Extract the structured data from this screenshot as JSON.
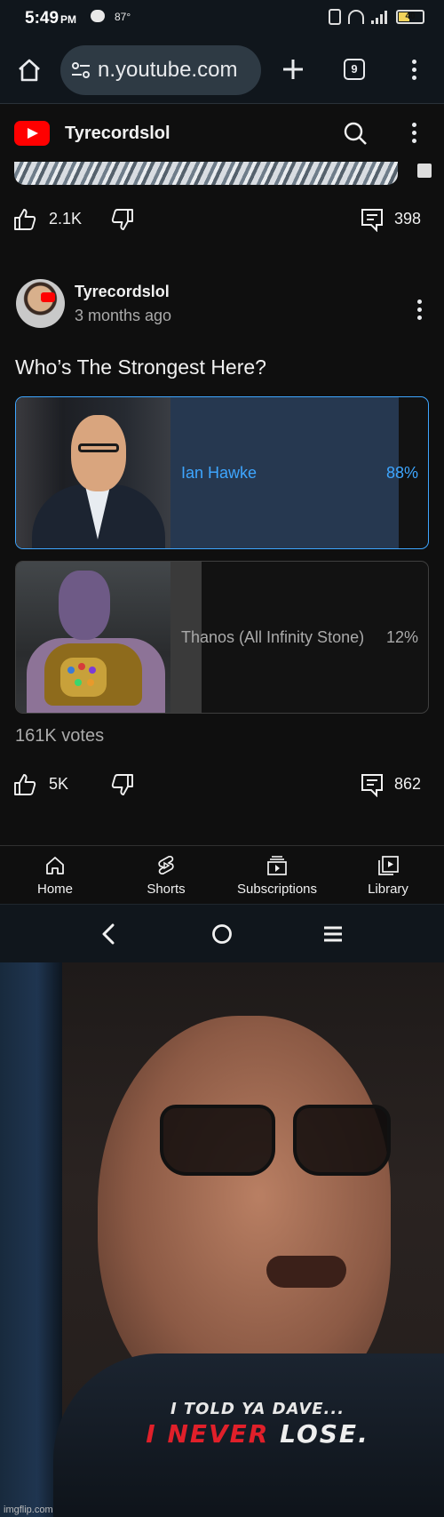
{
  "status_bar": {
    "time": "5:49",
    "ampm": "PM",
    "temperature": "87°",
    "battery": "40"
  },
  "browser": {
    "url": "n.youtube.com",
    "tab_count": "9"
  },
  "header": {
    "channel_title": "Tyrecordslol"
  },
  "previous_post": {
    "likes": "2.1K",
    "comments": "398"
  },
  "post": {
    "channel": "Tyrecordslol",
    "time_ago": "3 months ago",
    "question": "Who’s The Strongest Here?",
    "options": [
      {
        "label": "Ian Hawke",
        "percent": "88%",
        "value": 88,
        "selected": true
      },
      {
        "label": "Thanos (All Infinity Stone)",
        "percent": "12%",
        "value": 12,
        "selected": false
      }
    ],
    "votes": "161K votes",
    "likes": "5K",
    "comments": "862"
  },
  "bottom_nav": {
    "home": "Home",
    "shorts": "Shorts",
    "subscriptions": "Subscriptions",
    "library": "Library"
  },
  "meme": {
    "caption_line1": "I TOLD YA DAVE...",
    "caption_red": "I NEVER",
    "caption_white": " LOSE.",
    "watermark": "imgflip.com"
  },
  "colors": {
    "accent_blue": "#3ea6ff",
    "selected_bar": "#263850",
    "unselected_bar": "#3a3a3a",
    "youtube_red": "#ff0000",
    "background": "#0f0f0f"
  }
}
